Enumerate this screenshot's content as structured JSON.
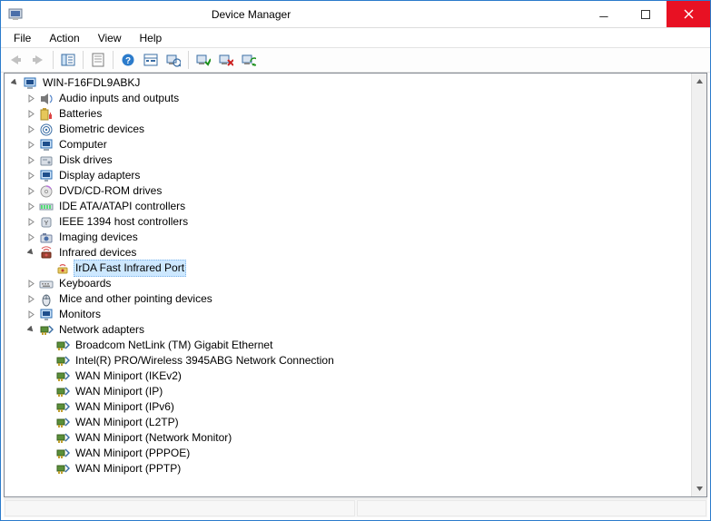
{
  "window": {
    "title": "Device Manager",
    "icon": "device-manager"
  },
  "menus": [
    "File",
    "Action",
    "View",
    "Help"
  ],
  "tree": {
    "root": {
      "label": "WIN-F16FDL9ABKJ",
      "icon": "computer",
      "expander": "open"
    },
    "categories": [
      {
        "label": "Audio inputs and outputs",
        "icon": "audio",
        "expander": "closed"
      },
      {
        "label": "Batteries",
        "icon": "battery",
        "expander": "closed"
      },
      {
        "label": "Biometric devices",
        "icon": "biometric",
        "expander": "closed"
      },
      {
        "label": "Computer",
        "icon": "computer",
        "expander": "closed"
      },
      {
        "label": "Disk drives",
        "icon": "disk",
        "expander": "closed"
      },
      {
        "label": "Display adapters",
        "icon": "display",
        "expander": "closed"
      },
      {
        "label": "DVD/CD-ROM drives",
        "icon": "optical",
        "expander": "closed"
      },
      {
        "label": "IDE ATA/ATAPI controllers",
        "icon": "ide",
        "expander": "closed"
      },
      {
        "label": "IEEE 1394 host controllers",
        "icon": "firewire",
        "expander": "closed"
      },
      {
        "label": "Imaging devices",
        "icon": "imaging",
        "expander": "closed"
      },
      {
        "label": "Infrared devices",
        "icon": "infrared",
        "expander": "open",
        "children": [
          {
            "label": "IrDA Fast Infrared Port",
            "icon": "infrared-port",
            "selected": true
          }
        ]
      },
      {
        "label": "Keyboards",
        "icon": "keyboard",
        "expander": "closed"
      },
      {
        "label": "Mice and other pointing devices",
        "icon": "mouse",
        "expander": "closed"
      },
      {
        "label": "Monitors",
        "icon": "monitor",
        "expander": "closed"
      },
      {
        "label": "Network adapters",
        "icon": "network",
        "expander": "open",
        "children": [
          {
            "label": "Broadcom NetLink (TM) Gigabit Ethernet",
            "icon": "network-adapter"
          },
          {
            "label": "Intel(R) PRO/Wireless 3945ABG Network Connection",
            "icon": "network-adapter"
          },
          {
            "label": "WAN Miniport (IKEv2)",
            "icon": "network-adapter"
          },
          {
            "label": "WAN Miniport (IP)",
            "icon": "network-adapter"
          },
          {
            "label": "WAN Miniport (IPv6)",
            "icon": "network-adapter"
          },
          {
            "label": "WAN Miniport (L2TP)",
            "icon": "network-adapter"
          },
          {
            "label": "WAN Miniport (Network Monitor)",
            "icon": "network-adapter"
          },
          {
            "label": "WAN Miniport (PPPOE)",
            "icon": "network-adapter"
          },
          {
            "label": "WAN Miniport (PPTP)",
            "icon": "network-adapter"
          }
        ]
      }
    ]
  }
}
